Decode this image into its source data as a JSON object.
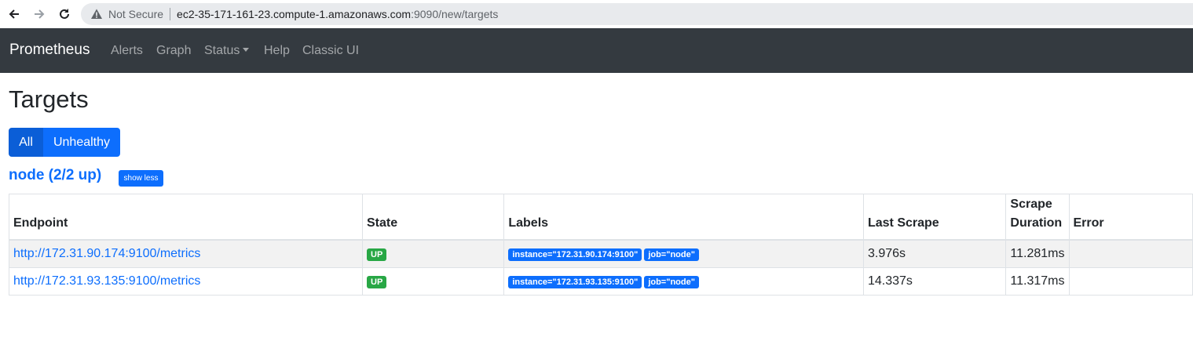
{
  "browser": {
    "security_label": "Not Secure",
    "url_host": "ec2-35-171-161-23.compute-1.amazonaws.com",
    "url_path": ":9090/new/targets"
  },
  "navbar": {
    "brand": "Prometheus",
    "links": [
      "Alerts",
      "Graph",
      "Status",
      "Help",
      "Classic UI"
    ]
  },
  "page": {
    "title": "Targets",
    "filter_all": "All",
    "filter_unhealthy": "Unhealthy"
  },
  "job": {
    "header": "node (2/2 up)",
    "toggle_label": "show less",
    "columns": [
      "Endpoint",
      "State",
      "Labels",
      "Last Scrape",
      "Scrape Duration",
      "Error"
    ],
    "rows": [
      {
        "endpoint": "http://172.31.90.174:9100/metrics",
        "state": "UP",
        "labels": [
          "instance=\"172.31.90.174:9100\"",
          "job=\"node\""
        ],
        "last_scrape": "3.976s",
        "scrape_duration": "11.281ms",
        "error": ""
      },
      {
        "endpoint": "http://172.31.93.135:9100/metrics",
        "state": "UP",
        "labels": [
          "instance=\"172.31.93.135:9100\"",
          "job=\"node\""
        ],
        "last_scrape": "14.337s",
        "scrape_duration": "11.317ms",
        "error": ""
      }
    ]
  },
  "icons": {
    "back": "arrow-left-icon",
    "forward": "arrow-right-icon",
    "reload": "reload-icon",
    "security": "warning-triangle-icon"
  },
  "colors": {
    "primary": "#0d6efd",
    "navbar": "#343a40",
    "success": "#28a745"
  }
}
